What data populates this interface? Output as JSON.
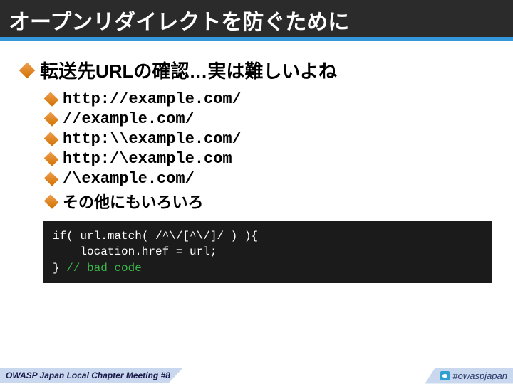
{
  "title": "オープンリダイレクトを防ぐために",
  "heading": "転送先URLの確認…実は難しいよね",
  "items": [
    "http://example.com/",
    "//example.com/",
    "http:\\\\example.com/",
    "http:/\\example.com",
    "/\\example.com/"
  ],
  "tail_item": "その他にもいろいろ",
  "code": {
    "l1": "if( url.match( /^\\/[^\\/]/ ) ){",
    "l2": "    location.href = url;",
    "l3a": "} ",
    "l3b": "// bad code"
  },
  "footer_left": "OWASP Japan Local Chapter Meeting #8",
  "footer_right": "#owaspjapan"
}
